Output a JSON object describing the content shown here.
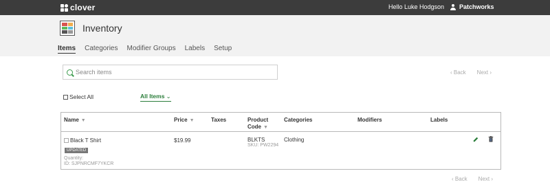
{
  "topbar": {
    "brand": "clover",
    "greeting": "Hello Luke Hodgson",
    "account": "Patchworks"
  },
  "header": {
    "title": "Inventory",
    "tabs": [
      {
        "label": "Items",
        "active": true
      },
      {
        "label": "Categories"
      },
      {
        "label": "Modifier Groups"
      },
      {
        "label": "Labels"
      },
      {
        "label": "Setup"
      }
    ]
  },
  "search": {
    "placeholder": "Search items"
  },
  "pager_top": {
    "back": "‹ Back",
    "next": "Next ›"
  },
  "pager_bottom": {
    "back": "‹ Back",
    "next": "Next ›"
  },
  "toolbar": {
    "select_all": "Select All",
    "filter": "All Items",
    "filter_chevron": "⌄"
  },
  "table": {
    "columns": {
      "name": "Name",
      "price": "Price",
      "taxes": "Taxes",
      "product_code_1": "Product",
      "product_code_2": "Code",
      "categories": "Categories",
      "modifiers": "Modifiers",
      "labels": "Labels"
    },
    "rows": [
      {
        "name": "Black T Shirt",
        "badge": "UPDATED",
        "quantity": "Quantity:",
        "id": "ID: SJPNRCMF7YKCR",
        "price": "$19.99",
        "product_code": "BLKTS",
        "sku": "SKU: PW2294",
        "categories": "Clothing"
      }
    ]
  },
  "colors": {
    "topbar": "#3c3c3c",
    "header_bg": "#f2f2f2",
    "accent_green": "#2a7d3a"
  }
}
